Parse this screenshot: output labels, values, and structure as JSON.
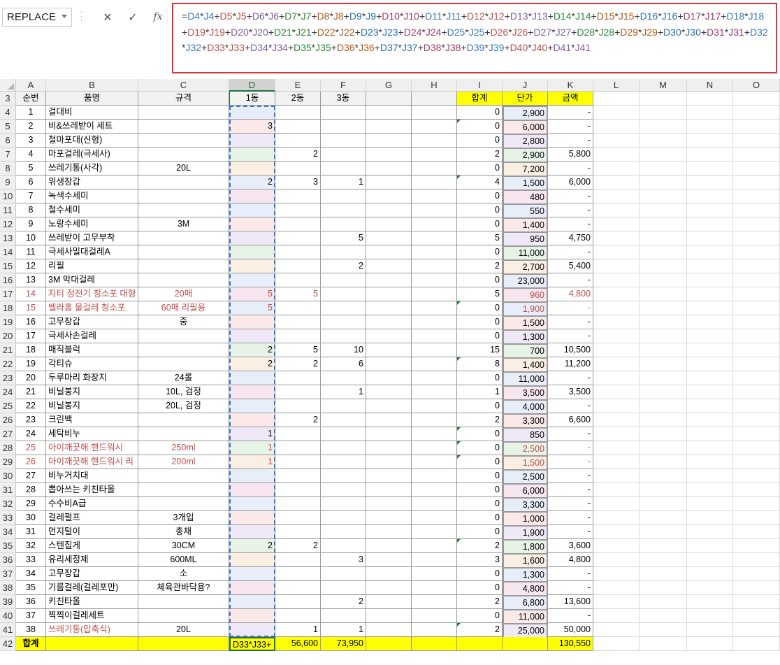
{
  "name_box": "REPLACE",
  "formula_buttons": {
    "cancel": "✕",
    "confirm": "✓",
    "fx": "fx"
  },
  "formula": "=D4*J4+D5*J5+D6*J6+D7*J7+D8*J8+D9*J9+D10*J10+D11*J11+D12*J12+D13*J13+D14*J14+D15*J15+D16*J16+D17*J17+D18*J18+D19*J19+D20*J20+D21*J21+D22*J22+D23*J23+D24*J24+D25*J25+D26*J26+D27*J27+D28*J28+D29*J29+D30*J30+D31*J31+D32*J32+D33*J33+D34*J34+D35*J35+D36*J36+D37*J37+D38*J38+D39*J39+D40*J40+D41*J41",
  "columns": [
    "A",
    "B",
    "C",
    "D",
    "E",
    "F",
    "G",
    "H",
    "I",
    "J",
    "K",
    "L",
    "M",
    "N",
    "O"
  ],
  "selected_column": "D",
  "header_row": {
    "row": "3",
    "A": "순번",
    "B": "품명",
    "C": "규격",
    "D": "1동",
    "E": "2동",
    "F": "3동",
    "I": "합계",
    "J": "단가",
    "K": "금액"
  },
  "rows": [
    {
      "row": "4",
      "A": "1",
      "B": "걸대비",
      "C": "",
      "D": "",
      "E": "",
      "F": "",
      "I": "0",
      "J": "2,900",
      "K": "-"
    },
    {
      "row": "5",
      "A": "2",
      "B": "비&쓰레받이 세트",
      "C": "",
      "D": "3",
      "E": "",
      "F": "",
      "I": "0",
      "J": "6,000",
      "K": "-",
      "tri": true
    },
    {
      "row": "6",
      "A": "3",
      "B": "철마포대(신형)",
      "C": "",
      "D": "",
      "E": "",
      "F": "",
      "I": "0",
      "J": "2,800",
      "K": "-"
    },
    {
      "row": "7",
      "A": "4",
      "B": "마포걸레(극세사)",
      "C": "",
      "D": "",
      "E": "2",
      "F": "",
      "I": "2",
      "J": "2,900",
      "K": "5,800"
    },
    {
      "row": "8",
      "A": "5",
      "B": "쓰레기통(사각)",
      "C": "20L",
      "D": "",
      "E": "",
      "F": "",
      "I": "0",
      "J": "7,200",
      "K": "-"
    },
    {
      "row": "9",
      "A": "6",
      "B": "위생장갑",
      "C": "",
      "D": "2",
      "E": "3",
      "F": "1",
      "I": "4",
      "J": "1,500",
      "K": "6,000",
      "tri": true
    },
    {
      "row": "10",
      "A": "7",
      "B": "녹색수세미",
      "C": "",
      "D": "",
      "E": "",
      "F": "",
      "I": "0",
      "J": "480",
      "K": "-"
    },
    {
      "row": "11",
      "A": "8",
      "B": "철수세미",
      "C": "",
      "D": "",
      "E": "",
      "F": "",
      "I": "0",
      "J": "550",
      "K": "-"
    },
    {
      "row": "12",
      "A": "9",
      "B": "노랑수세미",
      "C": "3M",
      "D": "",
      "E": "",
      "F": "",
      "I": "0",
      "J": "1,400",
      "K": "-"
    },
    {
      "row": "13",
      "A": "10",
      "B": "쓰레받이 고무부착",
      "C": "",
      "D": "",
      "E": "",
      "F": "5",
      "I": "5",
      "J": "950",
      "K": "4,750"
    },
    {
      "row": "14",
      "A": "11",
      "B": "극세사밀대걸레A",
      "C": "",
      "D": "",
      "E": "",
      "F": "",
      "I": "0",
      "J": "11,000",
      "K": "-"
    },
    {
      "row": "15",
      "A": "12",
      "B": "리필",
      "C": "",
      "D": "",
      "E": "",
      "F": "2",
      "I": "2",
      "J": "2,700",
      "K": "5,400"
    },
    {
      "row": "16",
      "A": "13",
      "B": "3M 막대걸레",
      "C": "",
      "D": "",
      "E": "",
      "F": "",
      "I": "0",
      "J": "23,000",
      "K": "-"
    },
    {
      "row": "17",
      "A": "14",
      "B": "지티 정전기 청소포 대형",
      "C": "20매",
      "D": "5",
      "E": "5",
      "F": "",
      "I": "5",
      "J": "960",
      "K": "4,800",
      "red": true
    },
    {
      "row": "18",
      "A": "15",
      "B": "벨라홈 물걸레 청소포",
      "C": "60매 리필용",
      "D": "5",
      "E": "",
      "F": "",
      "I": "0",
      "J": "1,900",
      "K": "-",
      "red": true,
      "tri": true
    },
    {
      "row": "19",
      "A": "16",
      "B": "고무장갑",
      "C": "중",
      "D": "",
      "E": "",
      "F": "",
      "I": "0",
      "J": "1,500",
      "K": "-"
    },
    {
      "row": "20",
      "A": "17",
      "B": "극세사손걸레",
      "C": "",
      "D": "",
      "E": "",
      "F": "",
      "I": "0",
      "J": "1,300",
      "K": "-"
    },
    {
      "row": "21",
      "A": "18",
      "B": "매직블럭",
      "C": "",
      "D": "2",
      "E": "5",
      "F": "10",
      "I": "15",
      "J": "700",
      "K": "10,500"
    },
    {
      "row": "22",
      "A": "19",
      "B": "각티슈",
      "C": "",
      "D": "2",
      "E": "2",
      "F": "6",
      "I": "8",
      "J": "1,400",
      "K": "11,200",
      "tri": true
    },
    {
      "row": "23",
      "A": "20",
      "B": "두루마리 화장지",
      "C": "24롤",
      "D": "",
      "E": "",
      "F": "",
      "I": "0",
      "J": "11,000",
      "K": "-"
    },
    {
      "row": "24",
      "A": "21",
      "B": "비닐봉지",
      "C": "10L, 검정",
      "D": "",
      "E": "",
      "F": "1",
      "I": "1",
      "J": "3,500",
      "K": "3,500"
    },
    {
      "row": "25",
      "A": "22",
      "B": "비닐봉지",
      "C": "20L, 검정",
      "D": "",
      "E": "",
      "F": "",
      "I": "0",
      "J": "4,000",
      "K": "-"
    },
    {
      "row": "26",
      "A": "23",
      "B": "크린백",
      "C": "",
      "D": "",
      "E": "2",
      "F": "",
      "I": "2",
      "J": "3,300",
      "K": "6,600"
    },
    {
      "row": "27",
      "A": "24",
      "B": "세탁비누",
      "C": "",
      "D": "1",
      "E": "",
      "F": "",
      "I": "0",
      "J": "850",
      "K": "-",
      "tri": true
    },
    {
      "row": "28",
      "A": "25",
      "B": "아이깨끗해 핸드워시",
      "C": "250ml",
      "D": "1",
      "E": "",
      "F": "",
      "I": "0",
      "J": "2,500",
      "K": "-",
      "red": true,
      "tri": true
    },
    {
      "row": "29",
      "A": "26",
      "B": "아이깨끗해 핸드워시 리",
      "C": "200ml",
      "D": "1",
      "E": "",
      "F": "",
      "I": "0",
      "J": "1,500",
      "K": "-",
      "red": true,
      "tri": true
    },
    {
      "row": "30",
      "A": "27",
      "B": "비누거치대",
      "C": "",
      "D": "",
      "E": "",
      "F": "",
      "I": "0",
      "J": "2,500",
      "K": "-"
    },
    {
      "row": "31",
      "A": "28",
      "B": "뽑아쓰는 키친타올",
      "C": "",
      "D": "",
      "E": "",
      "F": "",
      "I": "0",
      "J": "6,000",
      "K": "-"
    },
    {
      "row": "32",
      "A": "29",
      "B": "수수비A급",
      "C": "",
      "D": "",
      "E": "",
      "F": "",
      "I": "0",
      "J": "3,300",
      "K": "-"
    },
    {
      "row": "33",
      "A": "30",
      "B": "걸레펄프",
      "C": "3개입",
      "D": "",
      "E": "",
      "F": "",
      "I": "0",
      "J": "1,000",
      "K": "-"
    },
    {
      "row": "34",
      "A": "31",
      "B": "먼지털이",
      "C": "총채",
      "D": "",
      "E": "",
      "F": "",
      "I": "0",
      "J": "1,900",
      "K": "-"
    },
    {
      "row": "35",
      "A": "32",
      "B": "스텐집게",
      "C": "30CM",
      "D": "2",
      "E": "2",
      "F": "",
      "I": "2",
      "J": "1,800",
      "K": "3,600",
      "tri": true
    },
    {
      "row": "36",
      "A": "33",
      "B": "유리세정제",
      "C": "600ML",
      "D": "",
      "E": "",
      "F": "3",
      "I": "3",
      "J": "1,600",
      "K": "4,800"
    },
    {
      "row": "37",
      "A": "34",
      "B": "고무장갑",
      "C": "소",
      "D": "",
      "E": "",
      "F": "",
      "I": "0",
      "J": "1,300",
      "K": "-"
    },
    {
      "row": "38",
      "A": "35",
      "B": "기름걸레(걸레포만)",
      "C": "체육관바닥용?",
      "D": "",
      "E": "",
      "F": "",
      "I": "0",
      "J": "4,800",
      "K": "-"
    },
    {
      "row": "39",
      "A": "36",
      "B": "키친타올",
      "C": "",
      "D": "",
      "E": "",
      "F": "2",
      "I": "2",
      "J": "6,800",
      "K": "13,600"
    },
    {
      "row": "40",
      "A": "37",
      "B": "찍찍이걸레세트",
      "C": "",
      "D": "",
      "E": "",
      "F": "",
      "I": "0",
      "J": "11,000",
      "K": "-"
    },
    {
      "row": "41",
      "A": "38",
      "B": "쓰레기통(압축식)",
      "C": "20L",
      "D": "",
      "E": "1",
      "F": "1",
      "I": "2",
      "J": "25,000",
      "K": "50,000",
      "redB": true,
      "tri": true
    }
  ],
  "total_row": {
    "row": "42",
    "A": "합계",
    "D": "D33*J33+",
    "E": "56,600",
    "F": "73,950",
    "K": "130,550"
  },
  "colors": {
    "selected_border": "#217346",
    "highlight": "#ffff00",
    "formula_box_border": "#e0303a",
    "red_text": "#c0504d"
  }
}
